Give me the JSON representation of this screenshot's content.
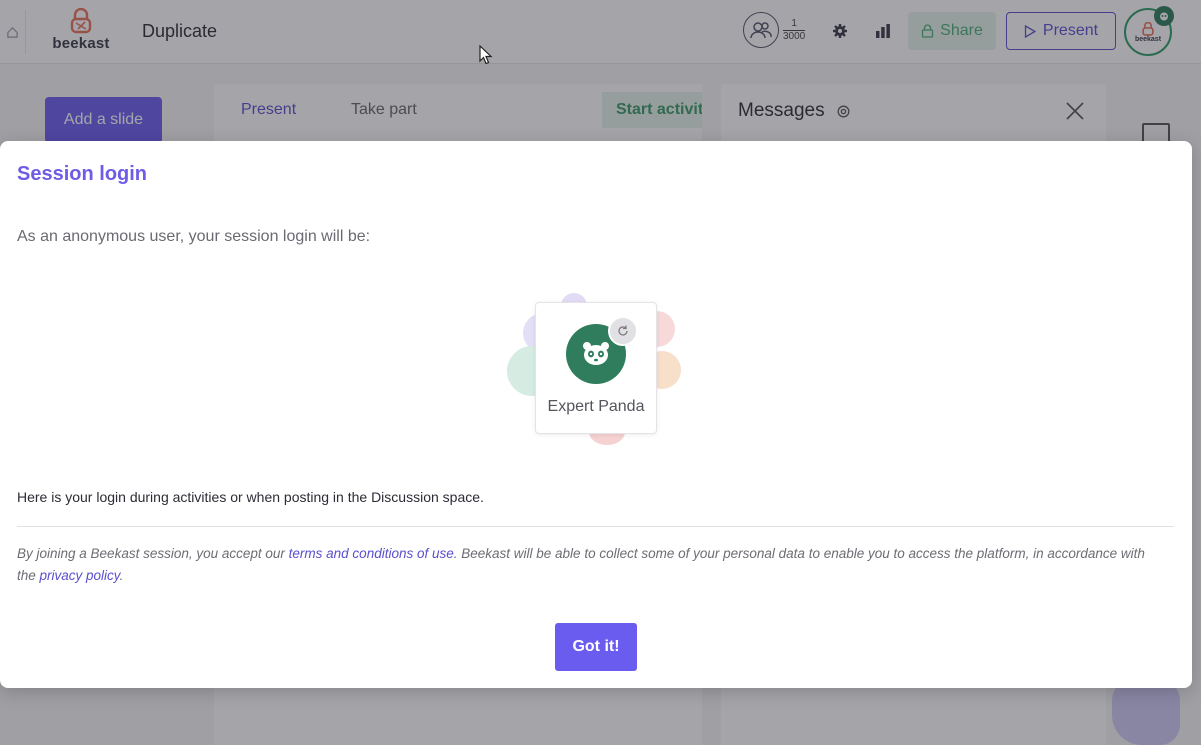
{
  "header": {
    "home_icon": "home-icon",
    "logo_text": "beekast",
    "doc_title": "Duplicate",
    "participants": {
      "current": "1",
      "max": "3000"
    },
    "share_label": "Share",
    "present_label": "Present",
    "avatar_text": "beekast"
  },
  "left": {
    "add_slide_label": "Add a slide"
  },
  "center": {
    "tab_present": "Present",
    "tab_take_part": "Take part",
    "start_activity_label": "Start activit"
  },
  "messages": {
    "title": "Messages"
  },
  "modal": {
    "title": "Session login",
    "intro": "As an anonymous user, your session login will be:",
    "avatar_name": "Expert Panda",
    "login_note": "Here is your login during activities or when posting in the Discussion space.",
    "legal_before": "By joining a Beekast session, you accept our ",
    "terms_link": "terms and conditions of use",
    "legal_middle": ". Beekast will be able to collect some of your personal data to enable you to access the platform, in accordance with the ",
    "privacy_link": "privacy policy",
    "legal_after": ".",
    "button_label": "Got it!"
  },
  "colors": {
    "accent": "#6b5cf0",
    "title_purple": "#6e5ce6",
    "green": "#2f7d5c",
    "share_bg": "#e4f3ea"
  }
}
